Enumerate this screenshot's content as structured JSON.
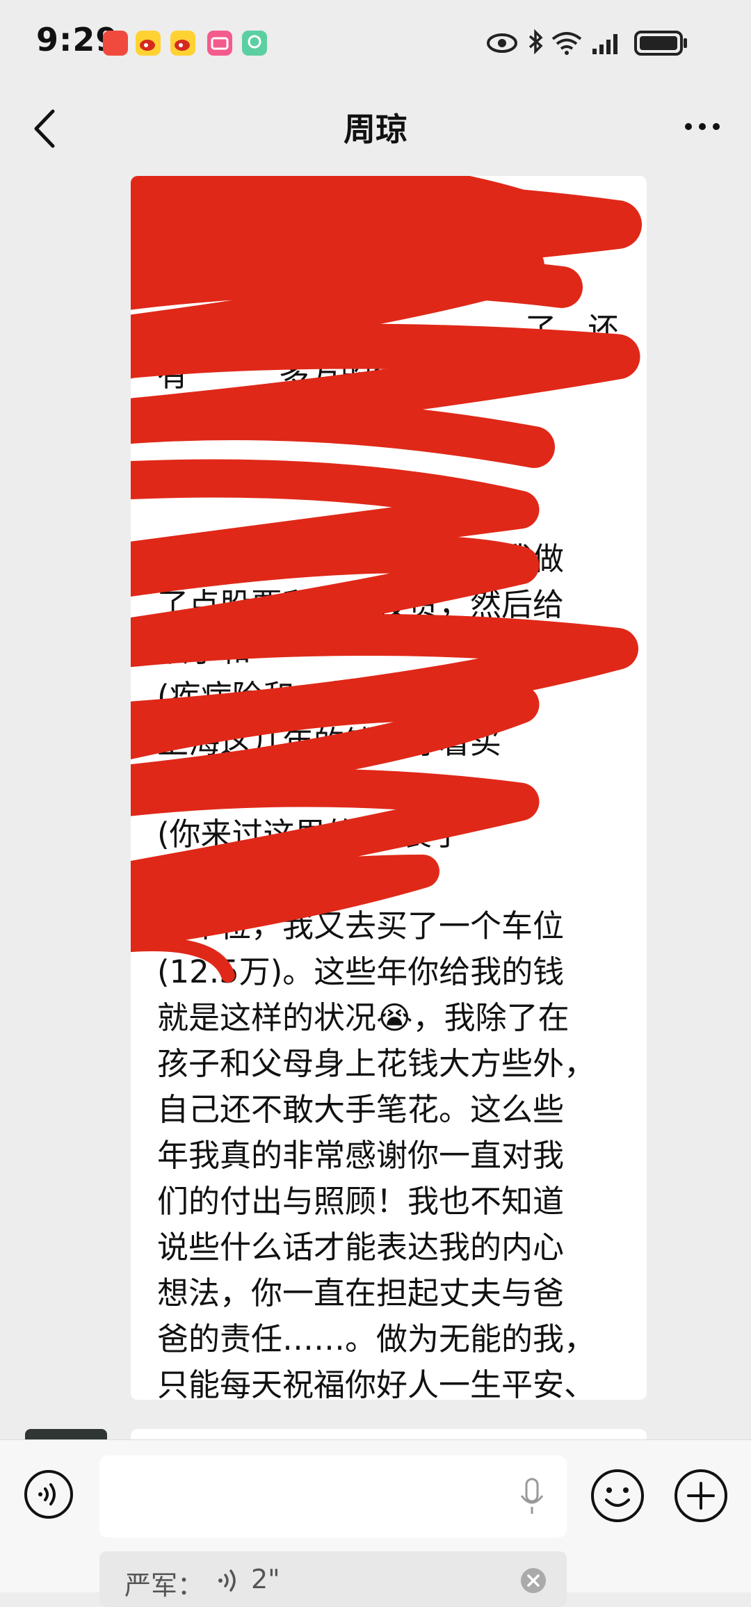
{
  "status_bar": {
    "time": "9:29",
    "notification_icons": [
      "app-notification-icon",
      "weibo-icon",
      "weibo-icon",
      "bilibili-icon",
      "app-icon"
    ],
    "indicators": [
      "eye-icon",
      "bluetooth-icon",
      "wifi-icon",
      "signal-icon",
      "battery-icon"
    ]
  },
  "nav": {
    "title": "周琼",
    "back_icon": "chevron-left-icon",
    "more_icon": "more-dots-icon"
  },
  "message": {
    "text": "的\n\n\n                                     了，还\n有         多万的债务，我的钱\n拿姐夫\n\n\n我的钱，除了必要开支，我做\n了点股票和基金投资，然后给\n孩子和\n(疾病险和一些投资险)\n上海这几年的钱我存着买\n\n(你来过这里的)重装了\n\n买车位，我又去买了一个车位\n(12.5万)。这些年你给我的钱\n就是这样的状况😭，我除了在\n孩子和父母身上花钱大方些外，\n自己还不敢大手笔花。这么些\n年我真的非常感谢你一直对我\n们的付出与照顾！我也不知道\n说些什么话才能表达我的内心\n想法，你一直在担起丈夫与爸\n爸的责任……。做为无能的我，\n只能每天祝福你好人一生平安、\n幸福！",
    "redaction_color": "#e02818"
  },
  "input": {
    "quote_sender": "严军：",
    "quote_duration": "2\"",
    "icons": [
      "voice-input-icon",
      "microphone-icon",
      "emoji-icon",
      "plus-icon",
      "close-icon"
    ]
  },
  "colors": {
    "background": "#ededed",
    "bubble": "#ffffff",
    "redaction": "#e02818"
  }
}
